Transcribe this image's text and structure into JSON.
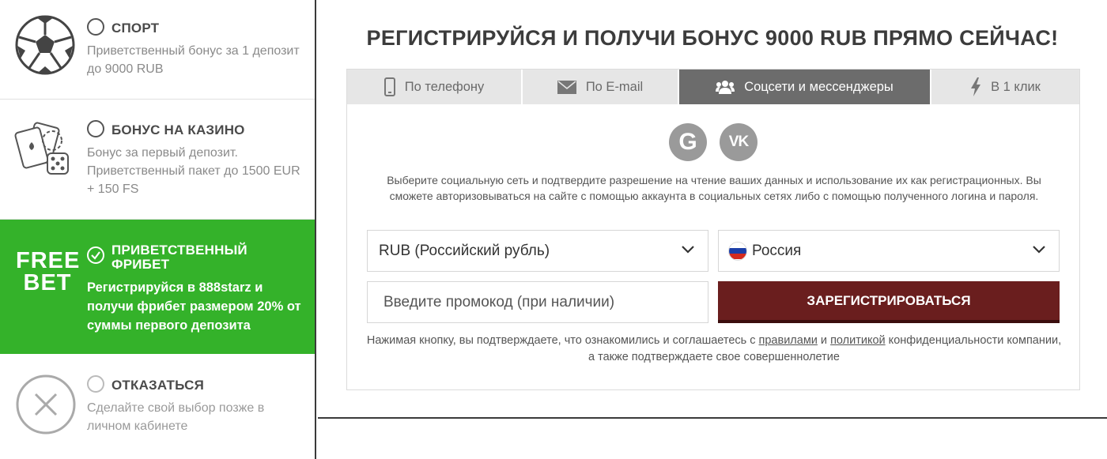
{
  "bonus_options": {
    "sport": {
      "title": "СПОРТ",
      "description": "Приветственный бонус за 1 депозит до 9000 RUB",
      "icon": "soccer-ball-icon",
      "selected": false
    },
    "casino": {
      "title": "БОНУС НА КАЗИНО",
      "description": "Бонус за первый депозит. Приветственный пакет до 1500 EUR + 150 FS",
      "icon": "cards-dice-icon",
      "selected": false
    },
    "freebet": {
      "logo_line1": "FREE",
      "logo_line2": "BET",
      "title": "ПРИВЕТСТВЕННЫЙ ФРИБЕТ",
      "description": "Регистрируйся в 888starz и получи фрибет размером 20% от суммы первого депозита",
      "selected": true,
      "color": "#34b22a"
    },
    "decline": {
      "title": "ОТКАЗАТЬСЯ",
      "description": "Сделайте свой выбор позже в личном кабинете",
      "icon": "close-circle-icon",
      "selected": false
    }
  },
  "registration": {
    "headline": "РЕГИСТРИРУЙСЯ И ПОЛУЧИ БОНУС 9000 RUB ПРЯМО СЕЙЧАС!",
    "tabs": [
      {
        "label": "По телефону",
        "icon": "phone-icon",
        "active": false
      },
      {
        "label": "По E-mail",
        "icon": "envelope-icon",
        "active": false
      },
      {
        "label": "Соцсети и мессенджеры",
        "icon": "users-icon",
        "active": true
      },
      {
        "label": "В 1 клик",
        "icon": "lightning-icon",
        "active": false
      }
    ],
    "social": [
      {
        "name": "google",
        "glyph": "G"
      },
      {
        "name": "vk",
        "glyph": "VK"
      }
    ],
    "info_text": "Выберите социальную сеть и подтвердите разрешение на чтение ваших данных и использование их как регистрационных. Вы сможете авторизовываться на сайте с помощью аккаунта в социальных сетях либо с помощью полученного логина и пароля.",
    "currency": "RUB (Российский рубль)",
    "country": "Россия",
    "promo_placeholder": "Введите промокод (при наличии)",
    "register_label": "ЗАРЕГИСТРИРОВАТЬСЯ",
    "legal_before": "Нажимая кнопку, вы подтверждаете, что ознакомились и соглашаетесь с ",
    "legal_rules_link": "правилами",
    "legal_and": " и ",
    "legal_policy_link": "политикой",
    "legal_after": " конфиденциальности компании, а также подтверждаете свое совершеннолетие",
    "accent_color": "#6a1e1e",
    "active_tab_color": "#6c6c6c"
  }
}
